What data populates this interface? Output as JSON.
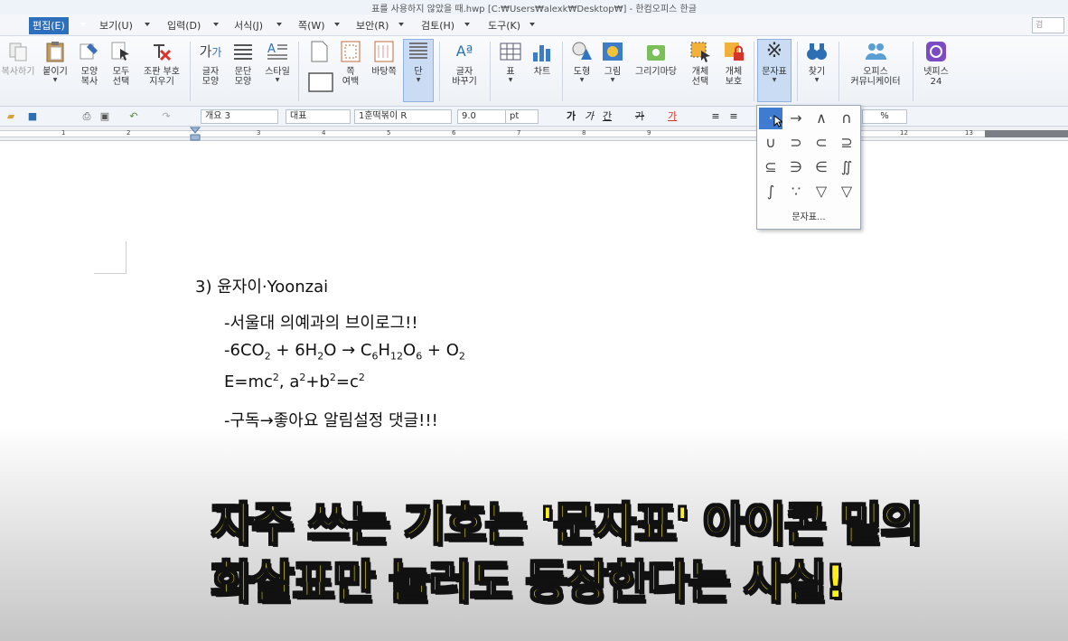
{
  "window": {
    "title": "표를 사용하지 않았을 때.hwp [C:₩Users₩alexk₩Desktop₩] - 한컴오피스 한글"
  },
  "menu": {
    "items": [
      "편집(E)",
      "보기(U)",
      "입력(D)",
      "서식(J)",
      "쪽(W)",
      "보안(R)",
      "검토(H)",
      "도구(K)"
    ],
    "search_placeholder": "검"
  },
  "ribbon": {
    "copy": "복사하기",
    "paste": "붙이기",
    "format_copy": "모양\n복사",
    "select_all": "모두\n선택",
    "clear_codes": "조판 부호\n지우기",
    "char_shape": "글자\n모양",
    "para_shape": "문단\n모양",
    "style": "스타일",
    "page_margin": "쪽\n여백",
    "page_bg": "바탕쪽",
    "columns": "단",
    "char_change": "글자\n바꾸기",
    "table": "표",
    "chart": "차트",
    "shape": "도형",
    "picture": "그림",
    "drawing": "그리기마당",
    "object_select": "개체\n선택",
    "object_protect": "개체\n보호",
    "char_map": "문자표",
    "find": "찾기",
    "office_community": "오피스\n커뮤니케이터",
    "netffice": "넷피스\n24"
  },
  "toolbar": {
    "outline_combo": "개요 3",
    "style_combo": "대표",
    "font_combo": "1훈떡볶이 R",
    "size_value": "9.0",
    "size_unit": "pt",
    "percent_label": "%",
    "bold": "가",
    "italic": "가",
    "underline": "간",
    "strike": "가",
    "color": "가"
  },
  "ruler": {
    "numbers": [
      "1",
      "2",
      "3",
      "4",
      "5",
      "6",
      "7",
      "8",
      "9",
      "10",
      "11",
      "12",
      "13"
    ]
  },
  "char_popup": {
    "symbols": [
      "·",
      "→",
      "∧",
      "∩",
      "∪",
      "⊃",
      "⊂",
      "⊇",
      "⊆",
      "∋",
      "∈",
      "∬",
      "∫",
      "∵",
      "▽",
      "▽"
    ],
    "more_label": "문자표..."
  },
  "document": {
    "line1": "3) 윤자이·Yoonzai",
    "line2": "-서울대 의예과의 브이로그!!",
    "line3_prefix": "-6CO",
    "line3_sub1": "2",
    "line3_mid1": " + 6H",
    "line3_sub2": "2",
    "line3_mid2": "O → C",
    "line3_sub3": "6",
    "line3_h": "H",
    "line3_sub4": "12",
    "line3_o": "O",
    "line3_sub5": "6",
    "line3_mid3": " + O",
    "line3_sub6": "2",
    "line4_a": "E=mc",
    "line4_sup1": "2",
    "line4_b": ", a",
    "line4_sup2": "2",
    "line4_c": "+b",
    "line4_sup3": "2",
    "line4_d": "=c",
    "line4_sup4": "2",
    "line5": "-구독→좋아요 알림설정 댓글!!!"
  },
  "caption": {
    "line1": "자주 쓰는 기호는 '문자표' 아이콘 밑의",
    "line2": "화살표만 눌러도 등장한다는 사실!"
  },
  "colors": {
    "accent": "#2c6fbd",
    "caption": "#ffef1a",
    "selected": "#3e7bd1"
  }
}
